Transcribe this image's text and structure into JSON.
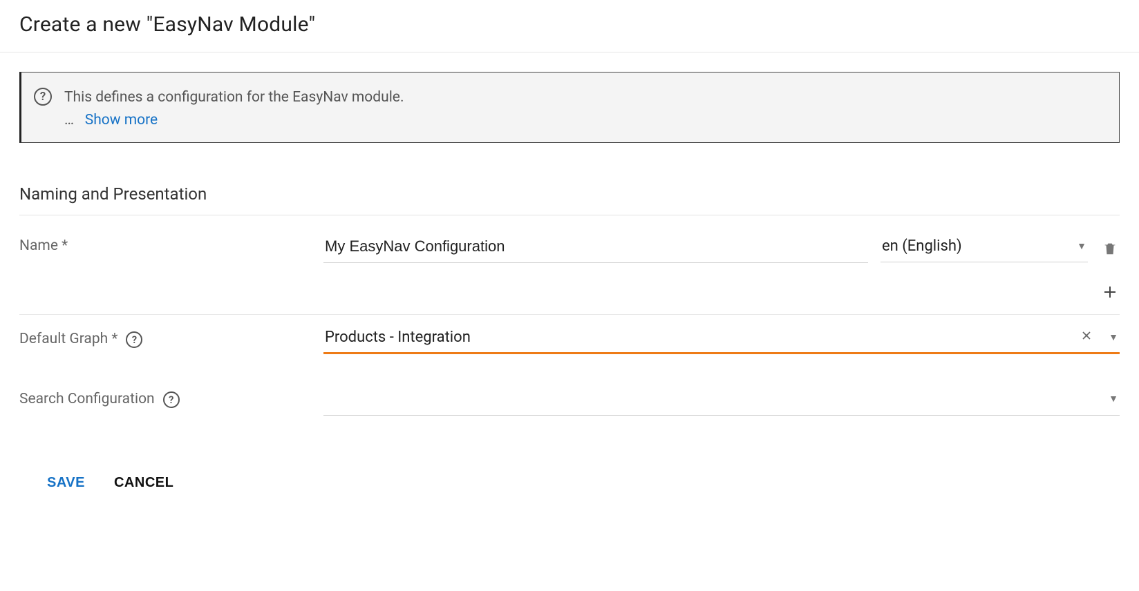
{
  "page": {
    "title": "Create a new \"EasyNav Module\""
  },
  "info": {
    "text": "This defines a configuration for the EasyNav module.",
    "ellipsis": "…",
    "show_more": "Show more"
  },
  "section": {
    "title": "Naming and Presentation"
  },
  "fields": {
    "name": {
      "label": "Name *",
      "value": "My EasyNav Configuration",
      "lang": "en (English)"
    },
    "default_graph": {
      "label": "Default Graph *",
      "value": "Products - Integration"
    },
    "search_config": {
      "label": "Search Configuration",
      "value": ""
    }
  },
  "actions": {
    "save": "SAVE",
    "cancel": "CANCEL"
  }
}
